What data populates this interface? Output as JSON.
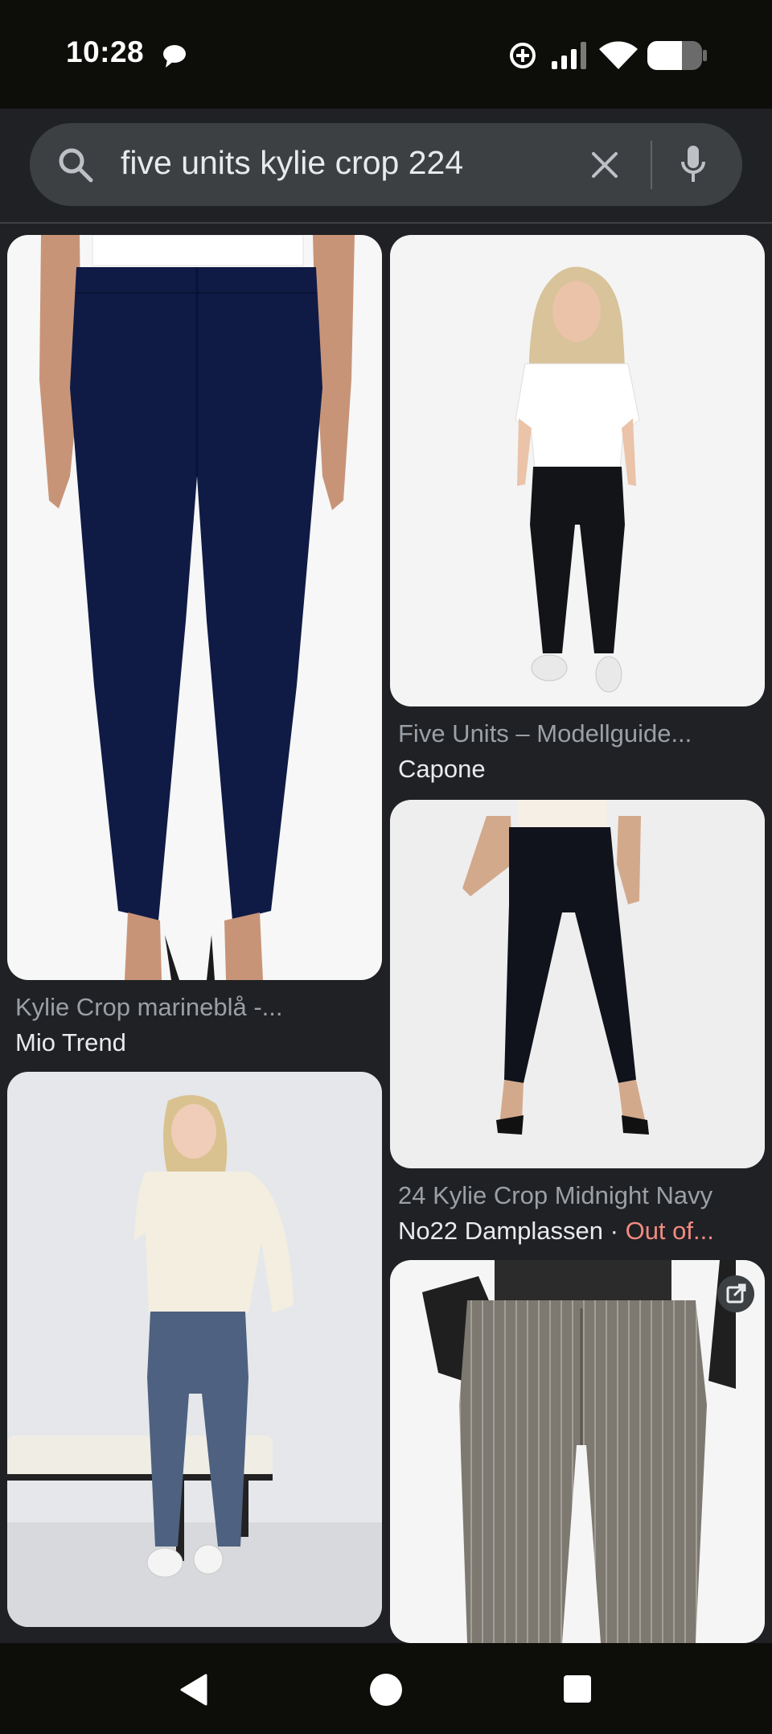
{
  "status_bar": {
    "time": "10:28",
    "icons": [
      "chat-bubble-icon",
      "data-saver-icon",
      "signal-icon",
      "wifi-icon",
      "battery-icon"
    ]
  },
  "search": {
    "query": "five units kylie crop 224",
    "icons": [
      "search-icon",
      "clear-icon",
      "mic-icon"
    ]
  },
  "results": [
    {
      "title": "Kylie Crop marineblå -...",
      "source": "Mio Trend",
      "stock": ""
    },
    {
      "title": "Five Units – Modellguide...",
      "source": "Capone",
      "stock": ""
    },
    {
      "title": "24 Kylie Crop Midnight Navy",
      "source": "No22 Damplassen · ",
      "stock": "Out of..."
    },
    {
      "title": "",
      "source": "",
      "stock": ""
    },
    {
      "title": "",
      "source": "",
      "stock": ""
    }
  ],
  "colors": {
    "background": "#202124",
    "search_pill": "#3c4043",
    "caption_title": "#9aa0a6",
    "caption_source": "#e8eaed",
    "out_of_stock": "#f28b82",
    "system_bar": "#0d0d0a"
  },
  "nav_bar": {
    "buttons": [
      "back-icon",
      "home-icon",
      "recents-icon"
    ]
  }
}
